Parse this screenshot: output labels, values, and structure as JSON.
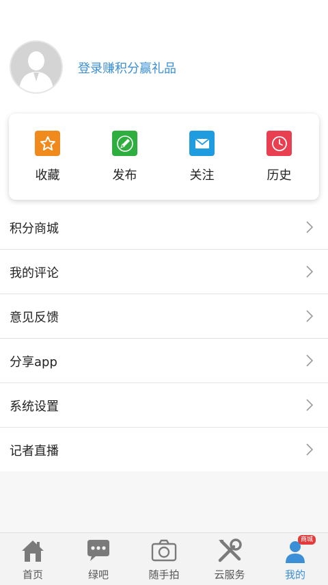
{
  "profile": {
    "login_text": "登录赚积分赢礼品"
  },
  "actions": [
    {
      "label": "收藏",
      "icon": "star-icon",
      "color": "#f08a1d"
    },
    {
      "label": "发布",
      "icon": "pen-icon",
      "color": "#2eae3e"
    },
    {
      "label": "关注",
      "icon": "mail-icon",
      "color": "#1f9be0"
    },
    {
      "label": "历史",
      "icon": "clock-icon",
      "color": "#e84050"
    }
  ],
  "menu": [
    {
      "label": "积分商城"
    },
    {
      "label": "我的评论"
    },
    {
      "label": "意见反馈"
    },
    {
      "label": "分享app"
    },
    {
      "label": "系统设置"
    },
    {
      "label": "记者直播"
    }
  ],
  "tabs": [
    {
      "label": "首页",
      "icon": "home-icon"
    },
    {
      "label": "绿吧",
      "icon": "chat-bubble-icon"
    },
    {
      "label": "随手拍",
      "icon": "camera-icon"
    },
    {
      "label": "云服务",
      "icon": "tools-icon"
    },
    {
      "label": "我的",
      "icon": "user-icon",
      "badge": "商城",
      "active": true
    }
  ],
  "colors": {
    "accent": "#3a8fd6",
    "tab_icon": "#7a7a7a"
  }
}
